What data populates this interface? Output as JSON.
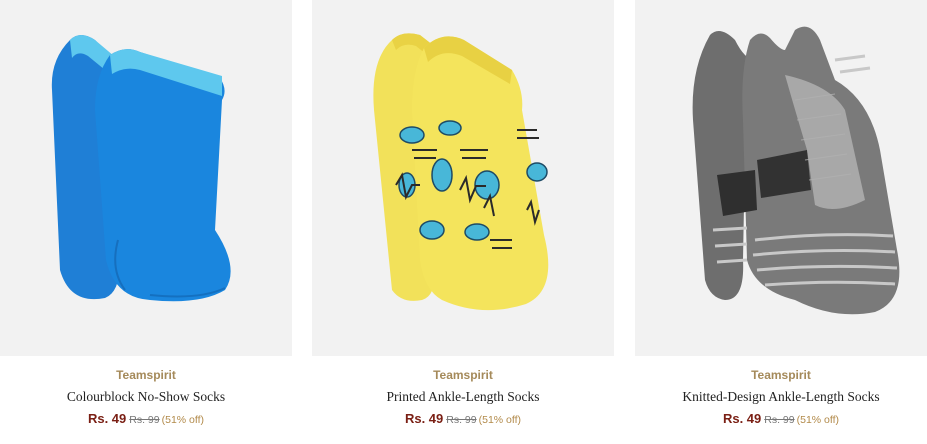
{
  "products": [
    {
      "brand": "Teamspirit",
      "name": "Colourblock No-Show Socks",
      "price": "Rs. 49",
      "mrp": "Rs. 99",
      "discount": "(51% off)",
      "image_icon": "blue-socks-image"
    },
    {
      "brand": "Teamspirit",
      "name": "Printed Ankle-Length Socks",
      "price": "Rs. 49",
      "mrp": "Rs. 99",
      "discount": "(51% off)",
      "image_icon": "yellow-printed-socks-image"
    },
    {
      "brand": "Teamspirit",
      "name": "Knitted-Design Ankle-Length Socks",
      "price": "Rs. 49",
      "mrp": "Rs. 99",
      "discount": "(51% off)",
      "image_icon": "grey-knitted-socks-image"
    }
  ],
  "colors": {
    "brand_text": "#a58a5a",
    "price_text": "#7a1f14",
    "image_bg": "#f2f2f2"
  }
}
